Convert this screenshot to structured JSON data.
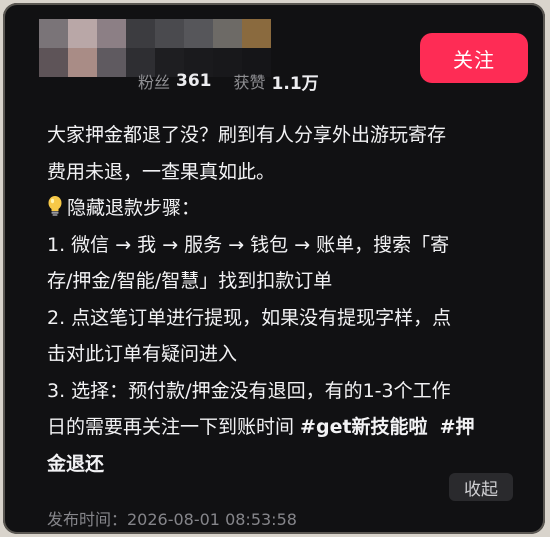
{
  "profile": {
    "fans_label": "粉丝",
    "fans_count": "361",
    "likes_label": "获赞",
    "likes_count": "1.1万",
    "avatar_mosaic_colors": [
      "#7a7478",
      "#b9a7a7",
      "#8c7f85",
      "#3c3c40",
      "#4a4a4e",
      "#56565a",
      "#6d6a66",
      "#8a6a3e",
      "#5e5458",
      "#a98c86",
      "#5f5a60",
      "#2e2e32",
      "#1e1e21",
      "#1a1a1d",
      "#18181b",
      "#151518"
    ]
  },
  "follow_button": {
    "label": "关注",
    "color": "#fe2c55"
  },
  "post": {
    "lines": [
      "大家押金都退了没？刷到有人分享外出游玩寄存",
      "费用未退，一查果真如此。",
      "隐藏退款步骤：",
      "1. 微信 → 我 → 服务 → 钱包 → 账单，搜索「寄",
      "存/押金/智能/智慧」找到扣款订单",
      "2. 点这笔订单进行提现，如果没有提现字样，点",
      "击对此订单有疑问进入",
      "3. 选择：预付款/押金没有退回，有的1-3个工作",
      "日的需要再关注一下到账时间 ",
      "金退还"
    ],
    "bulb_icon": "lightbulb-icon",
    "hashtag_1": "#get新技能啦",
    "hashtag_2_part1": "#押",
    "collapse_label": "收起",
    "publish_time": "发布时间：2026-08-01 08:53:58"
  }
}
